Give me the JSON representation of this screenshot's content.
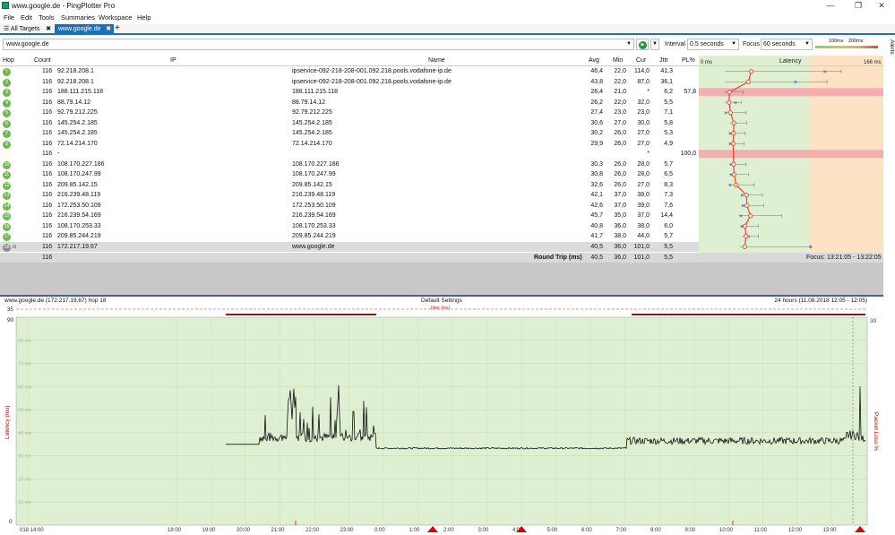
{
  "window": {
    "title": "www.google.de - PingPlotter Pro",
    "min_glyph": "—",
    "max_glyph": "❐",
    "close_glyph": "✕"
  },
  "menu": [
    "File",
    "Edit",
    "Tools",
    "Summaries",
    "Workspace",
    "Help"
  ],
  "tabs": {
    "all_targets": "All Targets",
    "active": "www.google.de",
    "close_glyph": "✖",
    "add_glyph": "+"
  },
  "toolbar": {
    "target": "www.google.de",
    "interval_label": "Interval",
    "interval_value": "0.5 seconds",
    "focus_label": "Focus",
    "focus_value": "60 seconds",
    "scale_100": "100ms",
    "scale_200": "200ms",
    "alerts": "Alerts"
  },
  "table": {
    "headers": {
      "hop": "Hop",
      "count": "Count",
      "ip": "IP",
      "name": "Name",
      "avg": "Avg",
      "min": "Min",
      "cur": "Cur",
      "jttr": "Jttr",
      "pl": "PL%",
      "latency": "Latency"
    },
    "latency_axis": {
      "left": "0 ms",
      "right": "166 ms",
      "max_ms": 166
    },
    "rows": [
      {
        "hop": "1",
        "count": "116",
        "ip": "92.218.208.1",
        "name": "ipservice-092-218-208-001.092.218.pools.vodafone-ip.de",
        "avg": "46,4",
        "min": "22,0",
        "cur": "114,0",
        "jttr": "41,3",
        "pl": "",
        "avg_ms": 46.4,
        "min_ms": 22,
        "cur_ms": 114,
        "jttr_ms": 41.3,
        "loss": 0
      },
      {
        "hop": "2",
        "count": "116",
        "ip": "92.218.208.1",
        "name": "ipservice-092-218-208-001.092.218.pools.vodafone-ip.de",
        "avg": "43,8",
        "min": "22,0",
        "cur": "87,0",
        "jttr": "36,1",
        "pl": "",
        "avg_ms": 43.8,
        "min_ms": 22,
        "cur_ms": 87,
        "jttr_ms": 36.1,
        "loss": 0
      },
      {
        "hop": "3",
        "count": "116",
        "ip": "188.111.215.118",
        "name": "188.111.215.118",
        "avg": "26,4",
        "min": "21,0",
        "cur": "*",
        "jttr": "6,2",
        "pl": "57,8",
        "avg_ms": 26.4,
        "min_ms": 21,
        "cur_ms": null,
        "jttr_ms": 6.2,
        "loss": 57.8
      },
      {
        "hop": "4",
        "count": "116",
        "ip": "88.79.14.12",
        "name": "88.79.14.12",
        "avg": "26,2",
        "min": "22,0",
        "cur": "32,0",
        "jttr": "5,5",
        "pl": "",
        "avg_ms": 26.2,
        "min_ms": 22,
        "cur_ms": 32,
        "jttr_ms": 5.5,
        "loss": 0
      },
      {
        "hop": "5",
        "count": "116",
        "ip": "92.79.212.225",
        "name": "92.79.212.225",
        "avg": "27,4",
        "min": "23,0",
        "cur": "23,0",
        "jttr": "7,1",
        "pl": "",
        "avg_ms": 27.4,
        "min_ms": 23,
        "cur_ms": 23,
        "jttr_ms": 7.1,
        "loss": 0
      },
      {
        "hop": "6",
        "count": "116",
        "ip": "145.254.2.185",
        "name": "145.254.2.185",
        "avg": "30,6",
        "min": "27,0",
        "cur": "30,0",
        "jttr": "5,8",
        "pl": "",
        "avg_ms": 30.6,
        "min_ms": 27,
        "cur_ms": 30,
        "jttr_ms": 5.8,
        "loss": 0
      },
      {
        "hop": "7",
        "count": "116",
        "ip": "145.254.2.185",
        "name": "145.254.2.185",
        "avg": "30,2",
        "min": "26,0",
        "cur": "27,0",
        "jttr": "5,3",
        "pl": "",
        "avg_ms": 30.2,
        "min_ms": 26,
        "cur_ms": 27,
        "jttr_ms": 5.3,
        "loss": 0
      },
      {
        "hop": "8",
        "count": "116",
        "ip": "72.14.214.170",
        "name": "72.14.214.170",
        "avg": "29,9",
        "min": "26,0",
        "cur": "27,0",
        "jttr": "4,9",
        "pl": "",
        "avg_ms": 29.9,
        "min_ms": 26,
        "cur_ms": 27,
        "jttr_ms": 4.9,
        "loss": 0
      },
      {
        "hop": "",
        "count": "116",
        "ip": "-",
        "name": "",
        "avg": "",
        "min": "",
        "cur": "*",
        "jttr": "",
        "pl": "100,0",
        "avg_ms": null,
        "min_ms": null,
        "cur_ms": null,
        "jttr_ms": null,
        "loss": 100
      },
      {
        "hop": "10",
        "count": "116",
        "ip": "108.170.227.186",
        "name": "108.170.227.186",
        "avg": "30,3",
        "min": "26,0",
        "cur": "28,0",
        "jttr": "5,7",
        "pl": "",
        "avg_ms": 30.3,
        "min_ms": 26,
        "cur_ms": 28,
        "jttr_ms": 5.7,
        "loss": 0
      },
      {
        "hop": "11",
        "count": "116",
        "ip": "108.170.247.99",
        "name": "108.170.247.99",
        "avg": "30,8",
        "min": "26,0",
        "cur": "28,0",
        "jttr": "6,5",
        "pl": "",
        "avg_ms": 30.8,
        "min_ms": 26,
        "cur_ms": 28,
        "jttr_ms": 6.5,
        "loss": 0
      },
      {
        "hop": "12",
        "count": "116",
        "ip": "209.85.142.15",
        "name": "209.85.142.15",
        "avg": "32,6",
        "min": "26,0",
        "cur": "27,0",
        "jttr": "8,3",
        "pl": "",
        "avg_ms": 32.6,
        "min_ms": 26,
        "cur_ms": 27,
        "jttr_ms": 8.3,
        "loss": 0
      },
      {
        "hop": "13",
        "count": "116",
        "ip": "216.239.48.119",
        "name": "216.239.48.119",
        "avg": "42,1",
        "min": "37,0",
        "cur": "38,0",
        "jttr": "7,3",
        "pl": "",
        "avg_ms": 42.1,
        "min_ms": 37,
        "cur_ms": 38,
        "jttr_ms": 7.3,
        "loss": 0
      },
      {
        "hop": "14",
        "count": "116",
        "ip": "172.253.50.109",
        "name": "172.253.50.109",
        "avg": "42,6",
        "min": "37,0",
        "cur": "39,0",
        "jttr": "7,6",
        "pl": "",
        "avg_ms": 42.6,
        "min_ms": 37,
        "cur_ms": 39,
        "jttr_ms": 7.6,
        "loss": 0
      },
      {
        "hop": "15",
        "count": "116",
        "ip": "216.239.54.169",
        "name": "216.239.54.169",
        "avg": "45,7",
        "min": "35,0",
        "cur": "37,0",
        "jttr": "14,4",
        "pl": "",
        "avg_ms": 45.7,
        "min_ms": 35,
        "cur_ms": 37,
        "jttr_ms": 14.4,
        "loss": 0
      },
      {
        "hop": "16",
        "count": "116",
        "ip": "108.170.253.33",
        "name": "108.170.253.33",
        "avg": "40,8",
        "min": "36,0",
        "cur": "38,0",
        "jttr": "6,0",
        "pl": "",
        "avg_ms": 40.8,
        "min_ms": 36,
        "cur_ms": 38,
        "jttr_ms": 6.0,
        "loss": 0
      },
      {
        "hop": "17",
        "count": "116",
        "ip": "209.85.244.219",
        "name": "209.85.244.219",
        "avg": "41,7",
        "min": "38,0",
        "cur": "44,0",
        "jttr": "5,7",
        "pl": "",
        "avg_ms": 41.7,
        "min_ms": 38,
        "cur_ms": 44,
        "jttr_ms": 5.7,
        "loss": 0
      },
      {
        "hop": "18",
        "count": "116",
        "ip": "172.217.19.67",
        "name": "www.google.de",
        "avg": "40,5",
        "min": "36,0",
        "cur": "101,0",
        "jttr": "5,5",
        "pl": "",
        "avg_ms": 40.5,
        "min_ms": 36,
        "cur_ms": 101,
        "jttr_ms": 5.5,
        "loss": 0,
        "selected": true
      }
    ],
    "summary": {
      "count": "116",
      "label": "Round Trip (ms)",
      "avg": "40,5",
      "min": "36,0",
      "cur": "101,0",
      "jttr": "5,5",
      "focus": "Focus: 13:21:05 - 13:22:05"
    }
  },
  "graph": {
    "header_left": "www.google.de (172.217.19.67) hop 18",
    "header_mid": "Default Settings",
    "header_right": "24 hours (11.08.2018 12:05 - 12:05)",
    "jitter_label": "Jitter (ms)",
    "jitter_scale_top": "35",
    "left_ylabel": "Latency (ms)",
    "right_ylabel": "Packet Loss %",
    "right_scale_top": "30",
    "y_max_label": "90",
    "y_zero_label": "0",
    "y_ticks": [
      "80 ms",
      "70 ms",
      "60 ms",
      "50 ms",
      "40 ms",
      "30 ms",
      "20 ms",
      "10 ms"
    ],
    "x_ticks": [
      "018 14:00",
      "18:00",
      "19:00",
      "20:00",
      "21:00",
      "22:00",
      "23:00",
      "0:00",
      "1:00",
      "2:00",
      "3:00",
      "4:00",
      "5:00",
      "6:00",
      "7:00",
      "8:00",
      "9:00",
      "10:00",
      "11:00",
      "12:00",
      "13:00"
    ],
    "colors": {
      "background": "#dff0d2",
      "line": "#111111",
      "loss": "#e00000"
    }
  }
}
